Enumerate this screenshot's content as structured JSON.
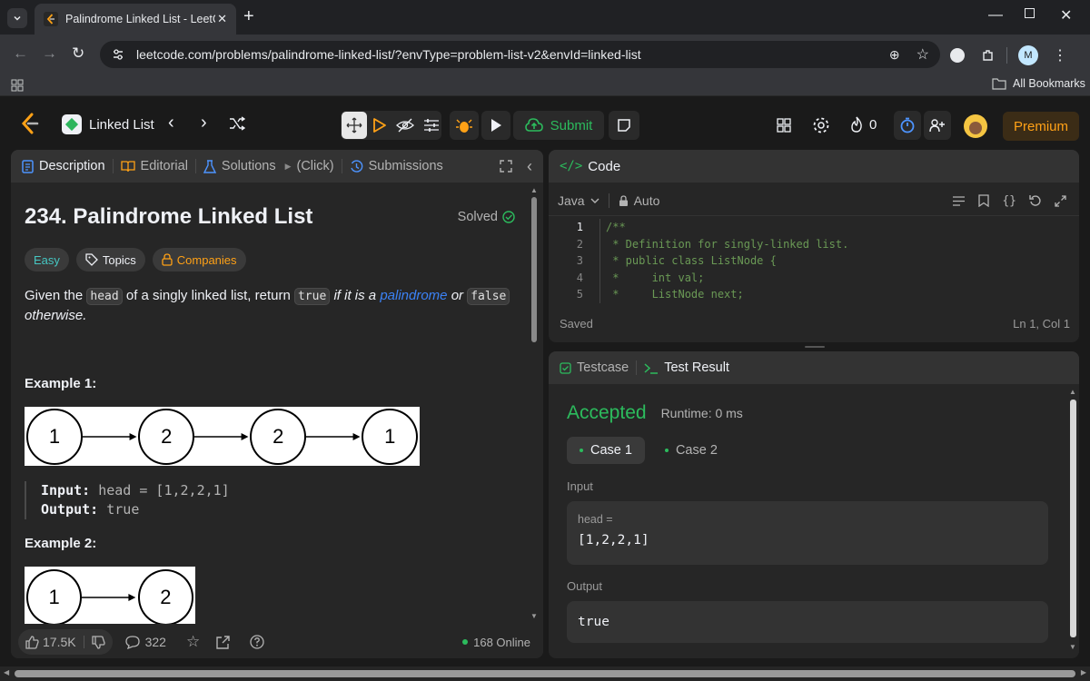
{
  "browser": {
    "tab_title": "Palindrome Linked List - LeetCode",
    "url": "leetcode.com/problems/palindrome-linked-list/?envType=problem-list-v2&envId=linked-list",
    "bookmarks_label": "All Bookmarks",
    "profile_initial": "M"
  },
  "nav": {
    "list_name": "Linked List",
    "submit_label": "Submit",
    "streak_count": "0",
    "premium_label": "Premium"
  },
  "left": {
    "tabs": {
      "description": "Description",
      "editorial": "Editorial",
      "solutions": "Solutions",
      "click": "(Click)",
      "submissions": "Submissions"
    },
    "title": "234. Palindrome Linked List",
    "solved_label": "Solved",
    "tags": {
      "difficulty": "Easy",
      "topics": "Topics",
      "companies": "Companies"
    },
    "desc": {
      "t1": "Given the",
      "c1": "head",
      "t2": "of a singly linked list, return",
      "c2": "true",
      "t3": "if it is a",
      "link": "palindrome",
      "t4": "or",
      "c3": "false",
      "t5": "otherwise."
    },
    "example1": {
      "heading": "Example 1:",
      "nodes": [
        "1",
        "2",
        "2",
        "1"
      ],
      "input_label": "Input:",
      "input_value": "head = [1,2,2,1]",
      "output_label": "Output:",
      "output_value": "true"
    },
    "example2": {
      "heading": "Example 2:",
      "nodes": [
        "1",
        "2"
      ]
    },
    "footer": {
      "likes": "17.5K",
      "comments": "322",
      "online": "168 Online"
    }
  },
  "code": {
    "header": "Code",
    "language": "Java",
    "mode": "Auto",
    "lines": [
      {
        "num": "1",
        "text": "/**"
      },
      {
        "num": "2",
        "text": " * Definition for singly-linked list."
      },
      {
        "num": "3",
        "text": " * public class ListNode {"
      },
      {
        "num": "4",
        "text": " *     int val;"
      },
      {
        "num": "5",
        "text": " *     ListNode next;"
      }
    ],
    "status": "Saved",
    "cursor": "Ln 1, Col 1"
  },
  "result": {
    "tab_testcase": "Testcase",
    "tab_result": "Test Result",
    "verdict": "Accepted",
    "runtime": "Runtime: 0 ms",
    "case1": "Case 1",
    "case2": "Case 2",
    "input_label": "Input",
    "input_var": "head =",
    "input_value": "[1,2,2,1]",
    "output_label": "Output",
    "output_value": "true"
  },
  "colors": {
    "accepted": "#2cbb5d",
    "easy": "#46c6c2",
    "premium": "#ffa116",
    "link": "#3b82f6",
    "online_dot": "#2cbb5d"
  }
}
